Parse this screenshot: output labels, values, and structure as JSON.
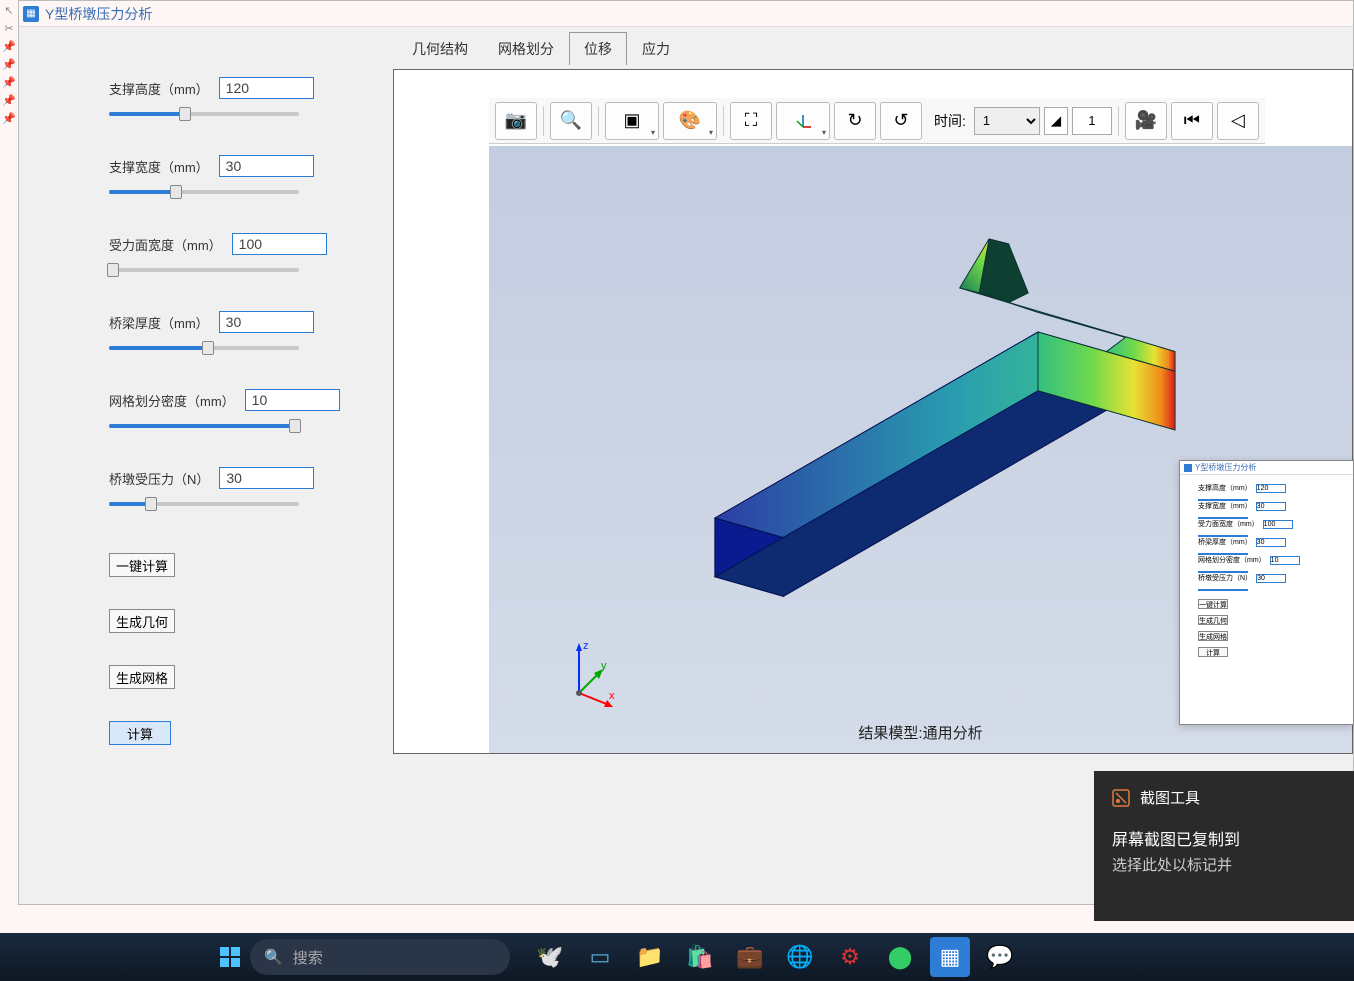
{
  "window": {
    "title": "Y型桥墩压力分析"
  },
  "params": [
    {
      "label": "支撑高度（mm）",
      "value": "120",
      "fill": 40
    },
    {
      "label": "支撑宽度（mm）",
      "value": "30",
      "fill": 35
    },
    {
      "label": "受力面宽度（mm）",
      "value": "100",
      "fill": 2
    },
    {
      "label": "桥梁厚度（mm）",
      "value": "30",
      "fill": 52
    },
    {
      "label": "网格划分密度（mm）",
      "value": "10",
      "fill": 98
    },
    {
      "label": "桥墩受压力（N）",
      "value": "30",
      "fill": 22
    }
  ],
  "buttons": {
    "calc_all": "一键计算",
    "gen_geom": "生成几何",
    "gen_mesh": "生成网格",
    "compute": "计算"
  },
  "tabs": [
    "几何结构",
    "网格划分",
    "位移",
    "应力"
  ],
  "active_tab": 2,
  "toolbar": {
    "time_label": "时间:",
    "time_value": "1",
    "step_value": "1"
  },
  "canvas": {
    "result_label": "结果模型:通用分析"
  },
  "toast": {
    "title": "截图工具",
    "line1": "屏幕截图已复制到",
    "line2": "选择此处以标记并"
  },
  "taskbar": {
    "search_placeholder": "搜索"
  },
  "popup": {
    "title": "Y型桥墩压力分析",
    "rows": [
      {
        "l": "支撑高度（mm）",
        "v": "120"
      },
      {
        "l": "支撑宽度（mm）",
        "v": "30"
      },
      {
        "l": "受力面宽度（mm）",
        "v": "100"
      },
      {
        "l": "桥梁厚度（mm）",
        "v": "30"
      },
      {
        "l": "网格划分密度（mm）",
        "v": "10"
      },
      {
        "l": "桥墩受压力（N）",
        "v": "30"
      }
    ],
    "btns": [
      "一键计算",
      "生成几何",
      "生成网格",
      "计算"
    ]
  }
}
